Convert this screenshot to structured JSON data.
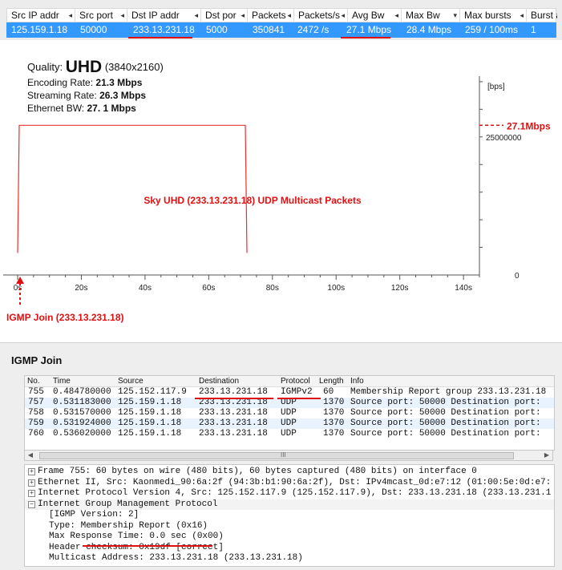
{
  "top_table": {
    "columns": [
      "Src IP addr",
      "Src port",
      "Dst IP addr",
      "Dst por",
      "Packets",
      "Packets/s",
      "Avg Bw",
      "Max Bw",
      "Max bursts",
      "Burst a"
    ],
    "row": [
      "125.159.1.18",
      "50000",
      "233.13.231.18",
      "5000",
      "350841",
      "2472 /s",
      "27.1 Mbps",
      "28.4 Mbps",
      "259 / 100ms",
      "1"
    ]
  },
  "quality": {
    "prefix": "Quality:",
    "value": "UHD",
    "resolution": "(3840x2160)"
  },
  "rates": {
    "encoding_label": "Encoding Rate:",
    "encoding_value": "21.3 Mbps",
    "streaming_label": "Streaming Rate:",
    "streaming_value": "26.3 Mbps",
    "ethernet_label": "Ethernet BW:",
    "ethernet_value": "27. 1 Mbps"
  },
  "chart_data": {
    "type": "line",
    "series": [
      {
        "values": [
          [
            0,
            4000000
          ],
          [
            0.5,
            27100000
          ],
          [
            71.5,
            27100000
          ],
          [
            72,
            4000000
          ]
        ]
      }
    ],
    "x_ticks": [
      "0s",
      "20s",
      "40s",
      "60s",
      "80s",
      "100s",
      "120s",
      "140s"
    ],
    "y_label": "[bps]",
    "y_tick": "25000000",
    "y_zero": "0",
    "level_label": "27.1Mbps",
    "center_label": "Sky UHD (233.13.231.18) UDP Multicast Packets",
    "join_label": "IGMP Join (233.13.231.18)",
    "xlim": [
      0,
      145
    ],
    "ylim": [
      0,
      36000000
    ],
    "colors": {
      "line": "#e8302e",
      "annotation": "#e01010"
    }
  },
  "igmp": {
    "title": "IGMP Join",
    "list_headers": [
      "No.",
      "Time",
      "Source",
      "Destination",
      "Protocol",
      "Length",
      "Info"
    ],
    "rows": [
      [
        "755",
        "0.484780000",
        "125.152.117.9",
        "233.13.231.18",
        "IGMPv2",
        "60",
        "Membership Report group 233.13.231.18"
      ],
      [
        "757",
        "0.531183000",
        "125.159.1.18",
        "233.13.231.18",
        "UDP",
        "1370",
        "Source port: 50000  Destination port:"
      ],
      [
        "758",
        "0.531570000",
        "125.159.1.18",
        "233.13.231.18",
        "UDP",
        "1370",
        "Source port: 50000  Destination port:"
      ],
      [
        "759",
        "0.531924000",
        "125.159.1.18",
        "233.13.231.18",
        "UDP",
        "1370",
        "Source port: 50000  Destination port:"
      ],
      [
        "760",
        "0.536020000",
        "125.159.1.18",
        "233.13.231.18",
        "UDP",
        "1370",
        "Source port: 50000  Destination port:"
      ]
    ],
    "scroll_grip": "III",
    "details": [
      "Frame 755: 60 bytes on wire (480 bits), 60 bytes captured (480 bits) on interface 0",
      "Ethernet II, Src: Kaonmedi_90:6a:2f (94:3b:b1:90:6a:2f), Dst: IPv4mcast_0d:e7:12 (01:00:5e:0d:e7:",
      "Internet Protocol Version 4, Src: 125.152.117.9 (125.152.117.9), Dst: 233.13.231.18 (233.13.231.1",
      "Internet Group Management Protocol",
      "[IGMP Version: 2]",
      "Type: Membership Report (0x16)",
      "Max Response Time: 0.0 sec (0x00)",
      "Header checksum: 0x19df [correct]",
      "Multicast Address: 233.13.231.18 (233.13.231.18)"
    ],
    "toggles": [
      "+",
      "+",
      "+",
      "−"
    ]
  }
}
